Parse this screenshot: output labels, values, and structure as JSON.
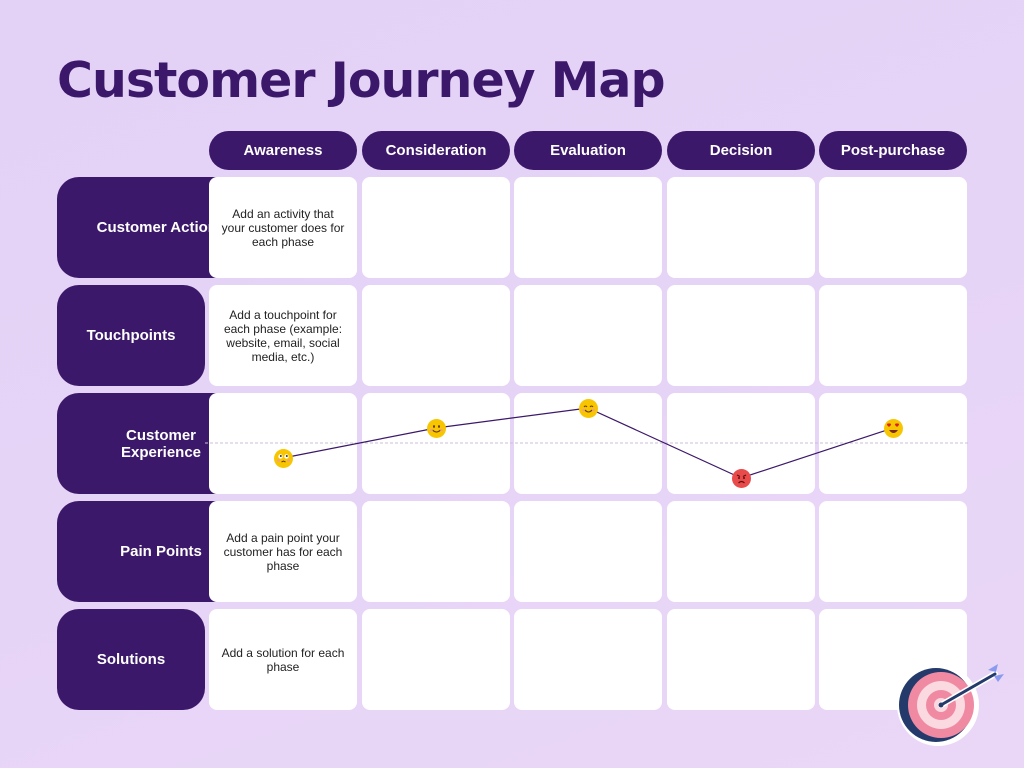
{
  "title": "Customer Journey Map",
  "phases": [
    "Awareness",
    "Consideration",
    "Evaluation",
    "Decision",
    "Post-purchase"
  ],
  "rows": [
    {
      "label": "Customer Actions",
      "cells": [
        "Add an activity that your customer does for each phase",
        "",
        "",
        "",
        ""
      ]
    },
    {
      "label": "Touchpoints",
      "cells": [
        "Add a touchpoint for each phase (example: website, email, social media, etc.)",
        "",
        "",
        "",
        ""
      ]
    },
    {
      "label": "Customer Experience",
      "cells": [
        "",
        "",
        "",
        "",
        ""
      ]
    },
    {
      "label": "Pain Points",
      "cells": [
        "Add a pain point your customer has for each phase",
        "",
        "",
        "",
        ""
      ]
    },
    {
      "label": "Solutions",
      "cells": [
        "Add a solution for each phase",
        "",
        "",
        "",
        ""
      ]
    }
  ],
  "experience": {
    "points": [
      {
        "phase": "Awareness",
        "emotion": "uneasy",
        "score": -0.3,
        "color": "#f7c600"
      },
      {
        "phase": "Consideration",
        "emotion": "smile",
        "score": 0.3,
        "color": "#f7c600"
      },
      {
        "phase": "Evaluation",
        "emotion": "happy",
        "score": 0.7,
        "color": "#f7c600"
      },
      {
        "phase": "Decision",
        "emotion": "angry",
        "score": -0.7,
        "color": "#e94a4a"
      },
      {
        "phase": "Post-purchase",
        "emotion": "heart-eyes",
        "score": 0.3,
        "color": "#f7c600"
      }
    ],
    "line_color": "#3b1869"
  },
  "colors": {
    "primary": "#3b1869",
    "background": "#e5d3f7",
    "cell": "#ffffff"
  },
  "decoration": "target-with-arrow-icon"
}
